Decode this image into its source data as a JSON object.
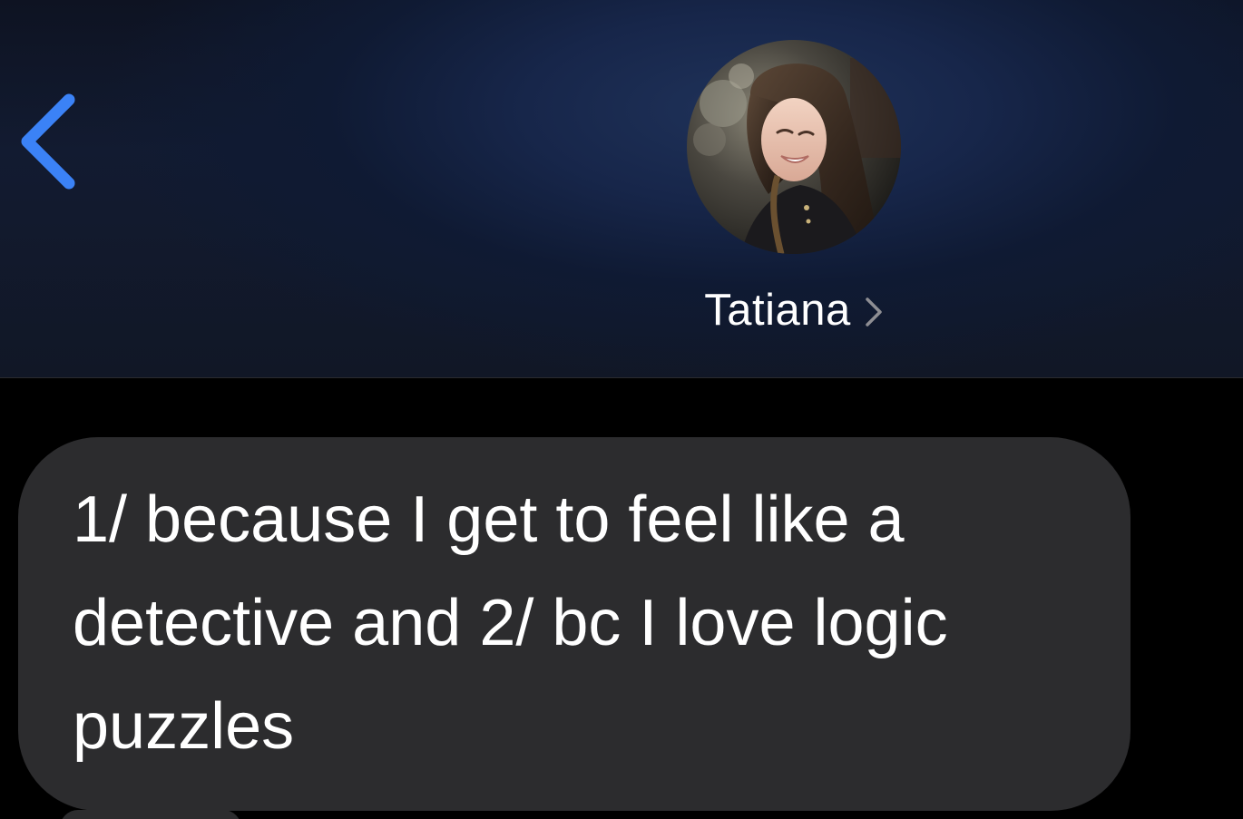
{
  "header": {
    "back_icon": "chevron-left-icon",
    "contact_name": "Tatiana",
    "contact_chevron_icon": "chevron-right-icon",
    "avatar_icon": "contact-avatar-photo"
  },
  "messages": [
    {
      "direction": "incoming",
      "text": "1/ because I get to feel like a detective and 2/ bc I love logic puzzles"
    }
  ],
  "colors": {
    "accent": "#3b82f6",
    "incoming_bubble": "#2c2c2e",
    "background": "#000000",
    "text": "#ffffff"
  }
}
